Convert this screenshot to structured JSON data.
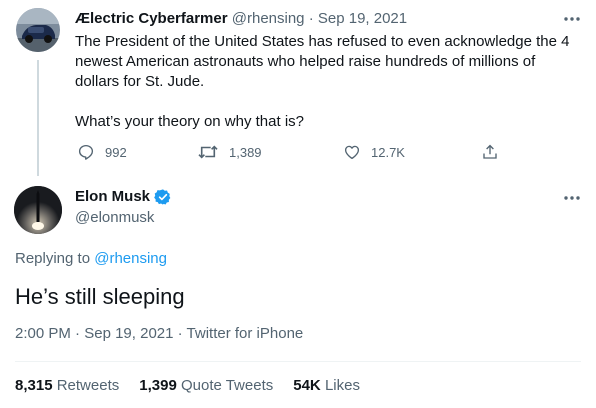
{
  "parent_tweet": {
    "author_name": "Ælectric Cyberfarmer",
    "author_handle": "@rhensing",
    "separator": "·",
    "date": "Sep 19, 2021",
    "text_line1": "The President of the United States has refused to even acknowledge the 4",
    "text_line2": "newest American astronauts who helped raise hundreds of millions of",
    "text_line3": "dollars for St. Jude.",
    "text_line4": "What’s your theory on why that is?",
    "replies": "992",
    "retweets": "1,389",
    "likes": "12.7K",
    "icons": [
      "reply-icon",
      "retweet-icon",
      "like-icon",
      "share-icon",
      "more-icon"
    ]
  },
  "main_tweet": {
    "author_name": "Elon Musk",
    "author_handle": "@elonmusk",
    "verified": true,
    "replying_prefix": "Replying to",
    "replying_handle": "@rhensing",
    "text": "He’s still sleeping",
    "time": "2:00 PM",
    "separator": "·",
    "date": "Sep 19, 2021",
    "source": "Twitter for iPhone"
  },
  "stats": {
    "retweets_count": "8,315",
    "retweets_label": "Retweets",
    "quotes_count": "1,399",
    "quotes_label": "Quote Tweets",
    "likes_count": "54K",
    "likes_label": "Likes"
  },
  "colors": {
    "accent": "#1d9bf0",
    "text": "#0f1419",
    "muted": "#536471",
    "divider": "#eff3f4"
  }
}
